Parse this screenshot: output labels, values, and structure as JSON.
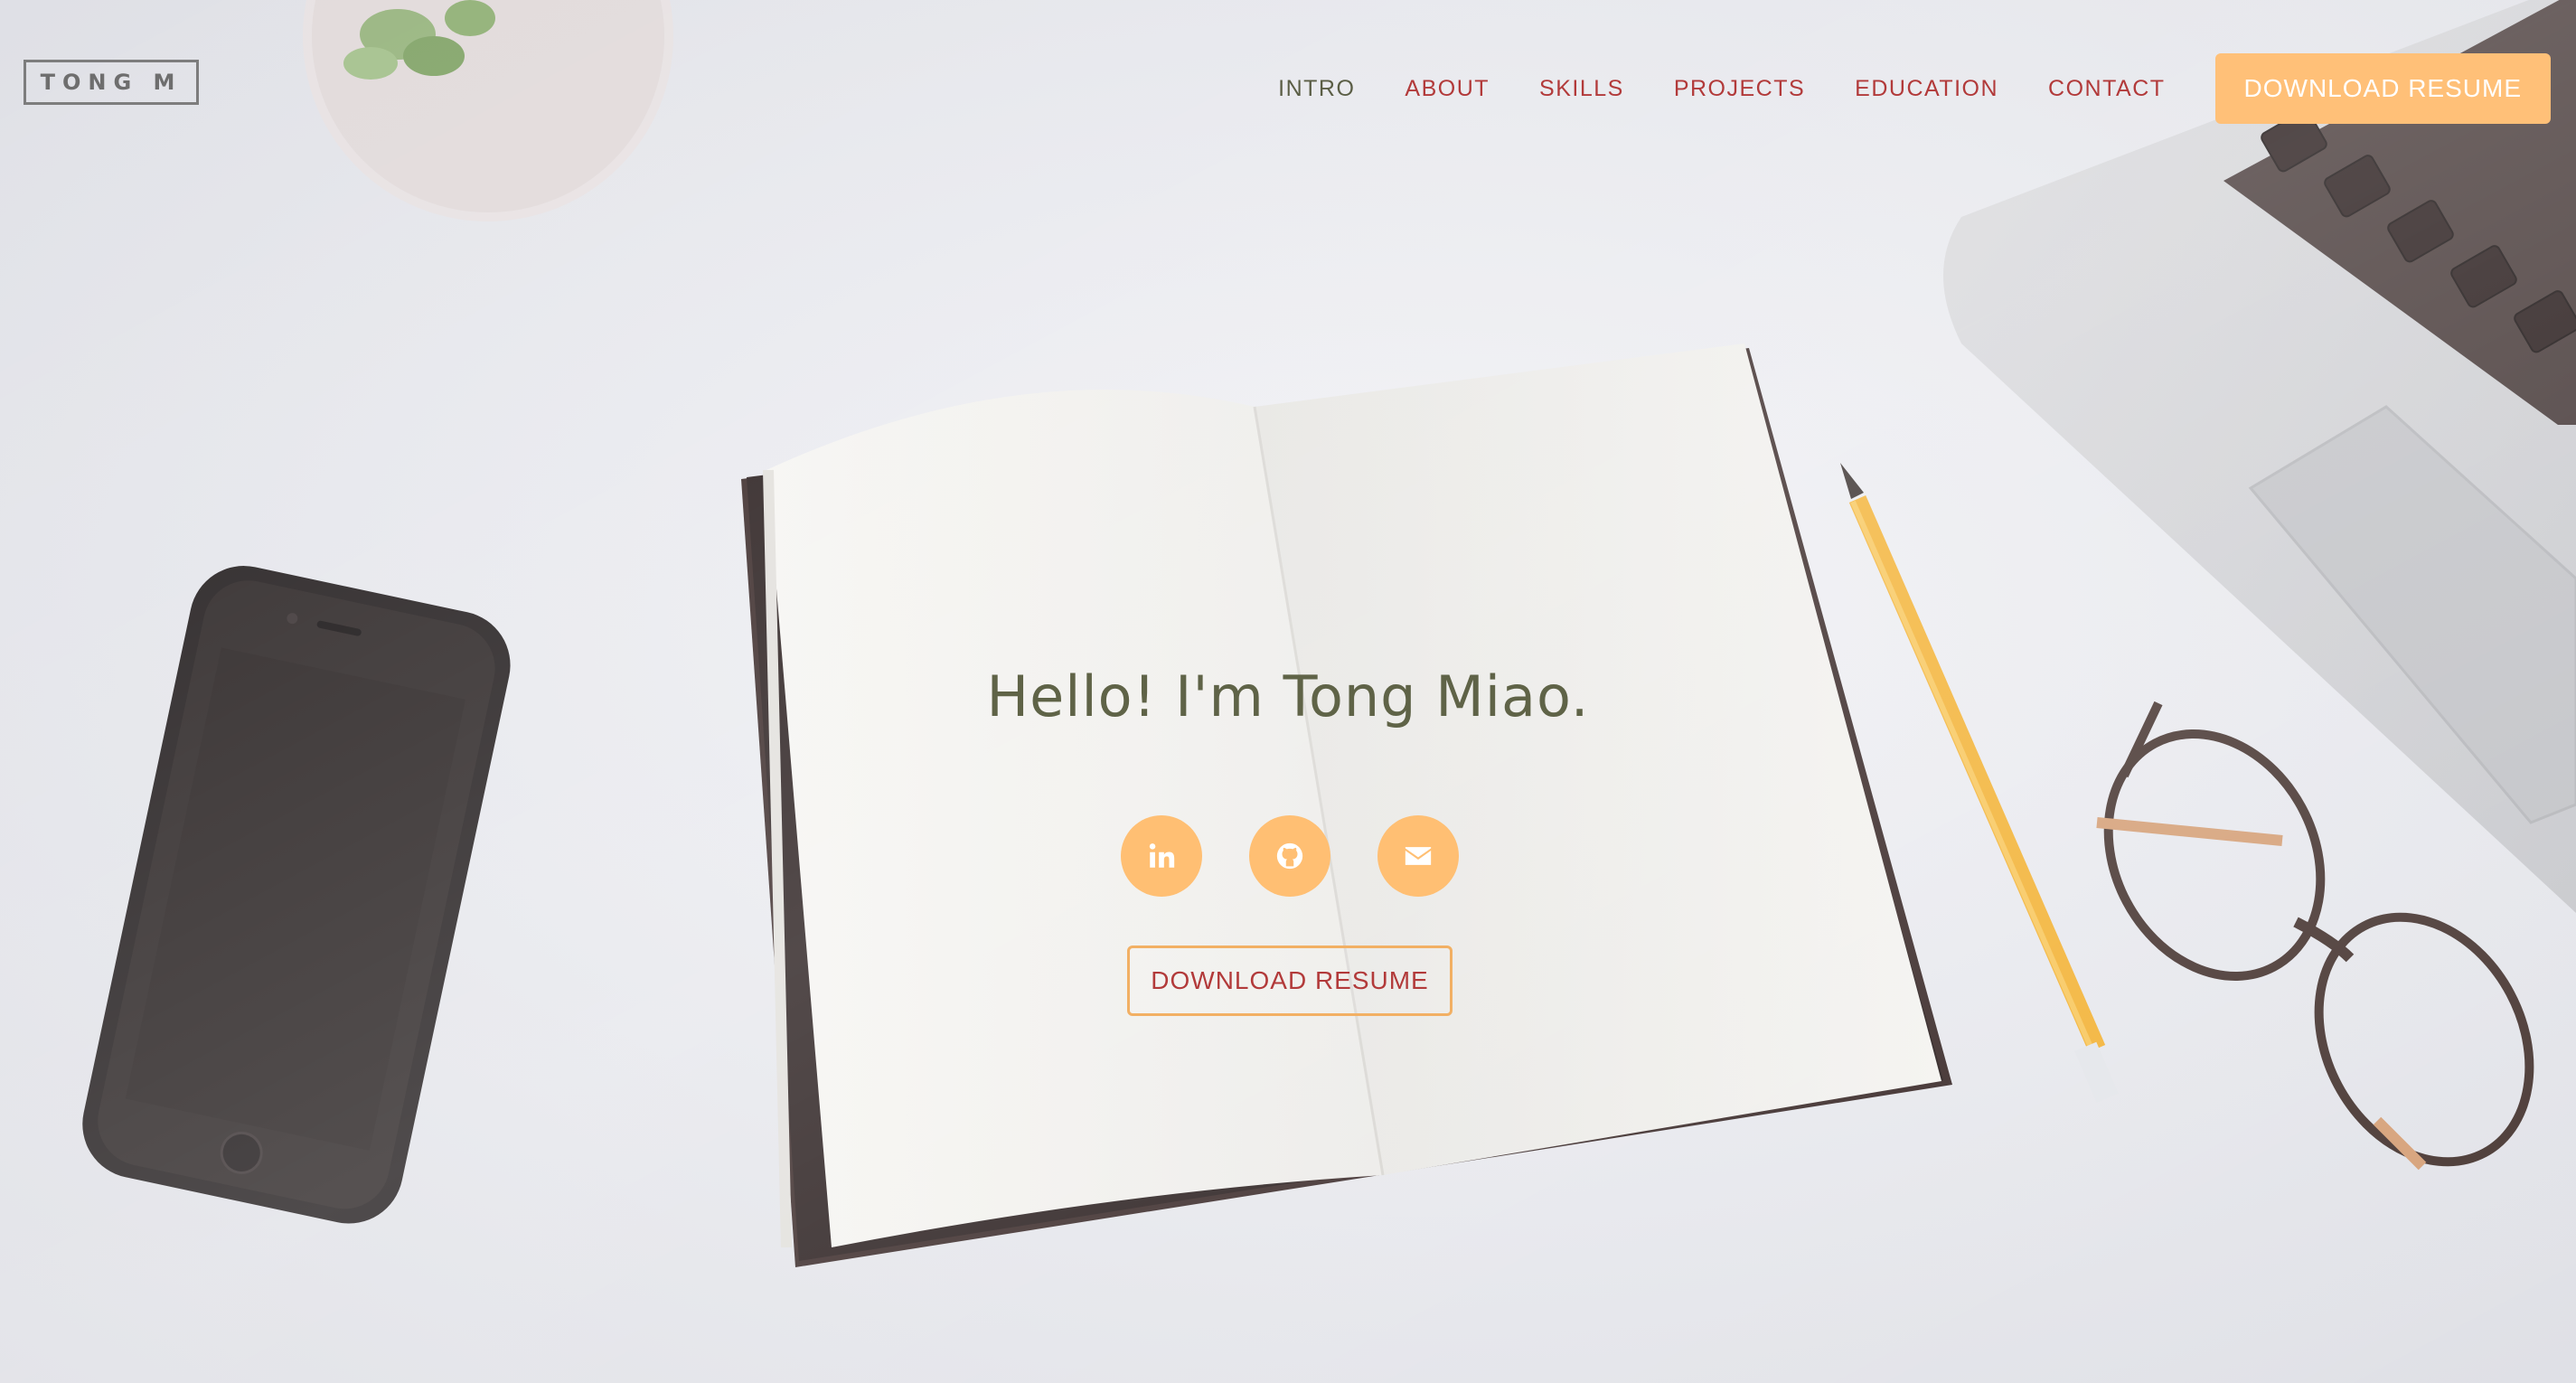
{
  "logo": {
    "text": "TONG M"
  },
  "nav": {
    "items": [
      {
        "label": "INTRO"
      },
      {
        "label": "ABOUT"
      },
      {
        "label": "SKILLS"
      },
      {
        "label": "PROJECTS"
      },
      {
        "label": "EDUCATION"
      },
      {
        "label": "CONTACT"
      }
    ],
    "resume_button": "DOWNLOAD RESUME"
  },
  "hero": {
    "headline": "Hello! I'm Tong Miao.",
    "socials": [
      {
        "icon": "linkedin-icon"
      },
      {
        "icon": "github-icon"
      },
      {
        "icon": "envelope-icon"
      }
    ],
    "resume_button": "DOWNLOAD RESUME"
  },
  "colors": {
    "accent": "#ffbf73",
    "nav_link": "#b23a3a",
    "nav_active": "#5b5e46",
    "headline": "#5f6347"
  }
}
